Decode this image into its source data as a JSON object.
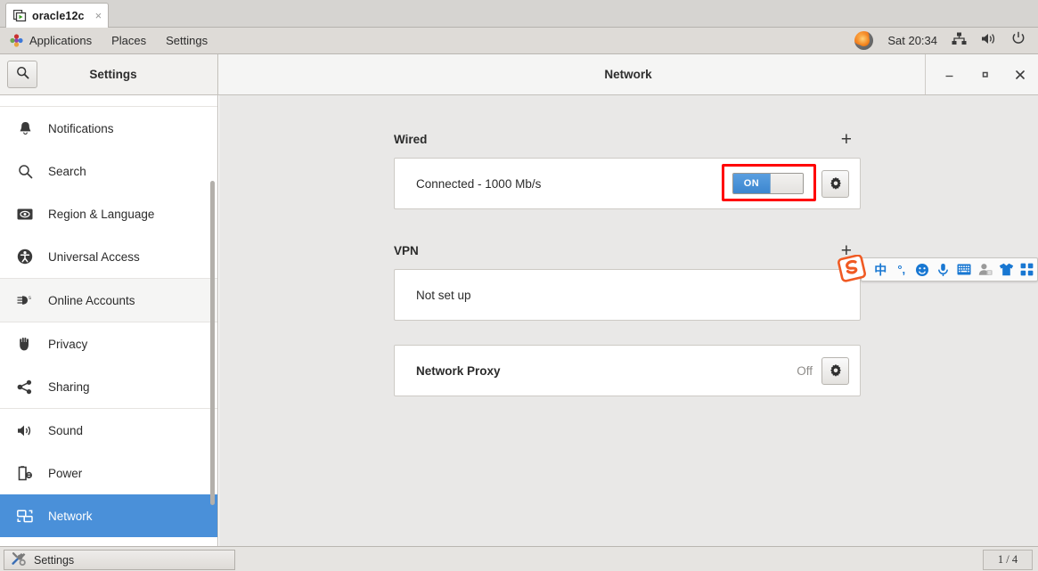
{
  "vm_tab": {
    "label": "oracle12c",
    "close": "×",
    "icon": "vm-screen-icon"
  },
  "panel": {
    "applications": "Applications",
    "places": "Places",
    "settings": "Settings",
    "clock": "Sat 20:34",
    "tray": [
      {
        "name": "firefox-icon"
      },
      {
        "name": "network-wired-icon"
      },
      {
        "name": "volume-icon"
      },
      {
        "name": "power-icon"
      }
    ]
  },
  "window": {
    "sidebar_title": "Settings",
    "title": "Network",
    "minimize": "–",
    "maximize": "□",
    "close": "✕",
    "search_icon": "search-icon"
  },
  "sidebar": {
    "items": [
      {
        "label": "Notifications",
        "icon": "bell-icon",
        "state": "normal"
      },
      {
        "label": "Search",
        "icon": "search-icon",
        "state": "normal"
      },
      {
        "label": "Region & Language",
        "icon": "region-language-icon",
        "state": "normal"
      },
      {
        "label": "Universal Access",
        "icon": "accessibility-icon",
        "state": "normal"
      },
      {
        "label": "Online Accounts",
        "icon": "online-accounts-icon",
        "state": "hover"
      },
      {
        "label": "Privacy",
        "icon": "hand-icon",
        "state": "normal"
      },
      {
        "label": "Sharing",
        "icon": "share-icon",
        "state": "normal"
      },
      {
        "label": "Sound",
        "icon": "speaker-icon",
        "state": "normal"
      },
      {
        "label": "Power",
        "icon": "battery-icon",
        "state": "normal"
      },
      {
        "label": "Network",
        "icon": "network-icon",
        "state": "selected"
      }
    ]
  },
  "main": {
    "wired": {
      "title": "Wired",
      "add_label": "+",
      "status": "Connected - 1000 Mb/s",
      "toggle_label": "ON",
      "toggle_on": true,
      "settings_icon": "gear-icon",
      "highlight_color": "#ff0000"
    },
    "vpn": {
      "title": "VPN",
      "add_label": "+",
      "status": "Not set up"
    },
    "proxy": {
      "title": "Network Proxy",
      "value": "Off",
      "settings_icon": "gear-icon"
    }
  },
  "ime": {
    "logo": "sogou-logo-icon",
    "buttons": [
      {
        "name": "chinese-mode-icon",
        "glyph": "中"
      },
      {
        "name": "punctuation-icon",
        "glyph": "°,"
      },
      {
        "name": "emoji-icon",
        "glyph": ""
      },
      {
        "name": "voice-input-icon",
        "glyph": ""
      },
      {
        "name": "soft-keyboard-icon",
        "glyph": ""
      },
      {
        "name": "user-account-icon",
        "glyph": ""
      },
      {
        "name": "skin-theme-icon",
        "glyph": ""
      },
      {
        "name": "toolbox-grid-icon",
        "glyph": ""
      }
    ]
  },
  "taskbar": {
    "task_label": "Settings",
    "task_icon": "tools-icon",
    "workspace": "1 / 4"
  },
  "colors": {
    "accent": "#4a90d9",
    "toggle_on": "#3c86cf",
    "highlight": "#ff0000",
    "ime_blue": "#1877d2"
  }
}
